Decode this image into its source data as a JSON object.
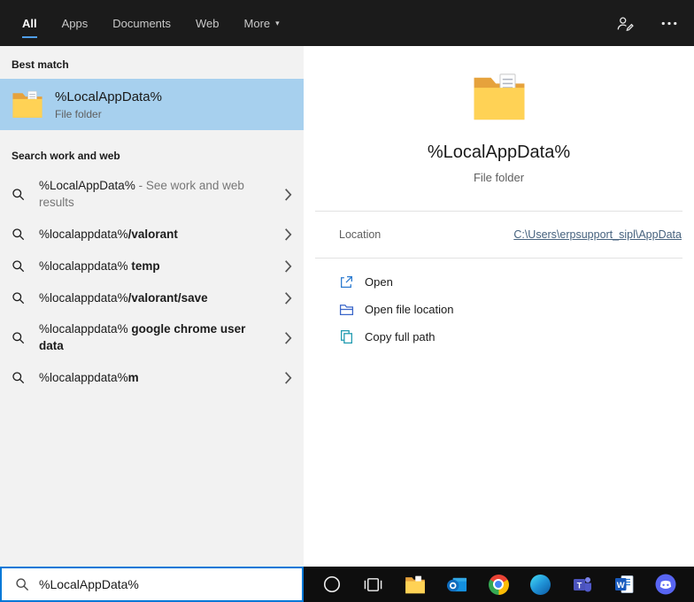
{
  "colors": {
    "accent": "#0078d7",
    "selected_tab_underline": "#4f9ee8",
    "best_match_highlight": "#a7d0ee"
  },
  "top_bar": {
    "tabs": [
      {
        "label": "All"
      },
      {
        "label": "Apps"
      },
      {
        "label": "Documents"
      },
      {
        "label": "Web"
      },
      {
        "label": "More"
      }
    ],
    "icons": [
      "account-icon",
      "ellipsis-icon"
    ]
  },
  "left_panel": {
    "best_match": {
      "section_title": "Best match",
      "title": "%LocalAppData%",
      "subtitle": "File folder",
      "icon": "folder-icon"
    },
    "suggestions": {
      "section_title": "Search work and web",
      "items": [
        {
          "base": "%LocalAppData%",
          "bold": "",
          "muted": " - See work and web results"
        },
        {
          "base": "%localappdata%",
          "bold": "/valorant",
          "muted": ""
        },
        {
          "base": "%localappdata%",
          "bold": " temp",
          "muted": ""
        },
        {
          "base": "%localappdata%",
          "bold": "/valorant/save",
          "muted": ""
        },
        {
          "base": "%localappdata%",
          "bold": " google chrome user data",
          "muted": ""
        },
        {
          "base": "%localappdata%",
          "bold": "m",
          "muted": ""
        }
      ]
    }
  },
  "preview": {
    "icon": "folder-icon",
    "title": "%LocalAppData%",
    "subtitle": "File folder",
    "location": {
      "label": "Location",
      "value": "C:\\Users\\erpsupport_sipl\\AppData"
    },
    "actions": [
      {
        "label": "Open",
        "icon": "open-icon"
      },
      {
        "label": "Open file location",
        "icon": "open-file-location-icon"
      },
      {
        "label": "Copy full path",
        "icon": "copy-icon"
      }
    ]
  },
  "search_box": {
    "value": "%LocalAppData%",
    "icon": "search-icon"
  },
  "taskbar": {
    "icons": [
      "cortana-icon",
      "task-view-icon",
      "file-explorer-icon",
      "outlook-icon",
      "chrome-icon",
      "edge-icon",
      "teams-icon",
      "word-icon",
      "discord-icon"
    ]
  }
}
